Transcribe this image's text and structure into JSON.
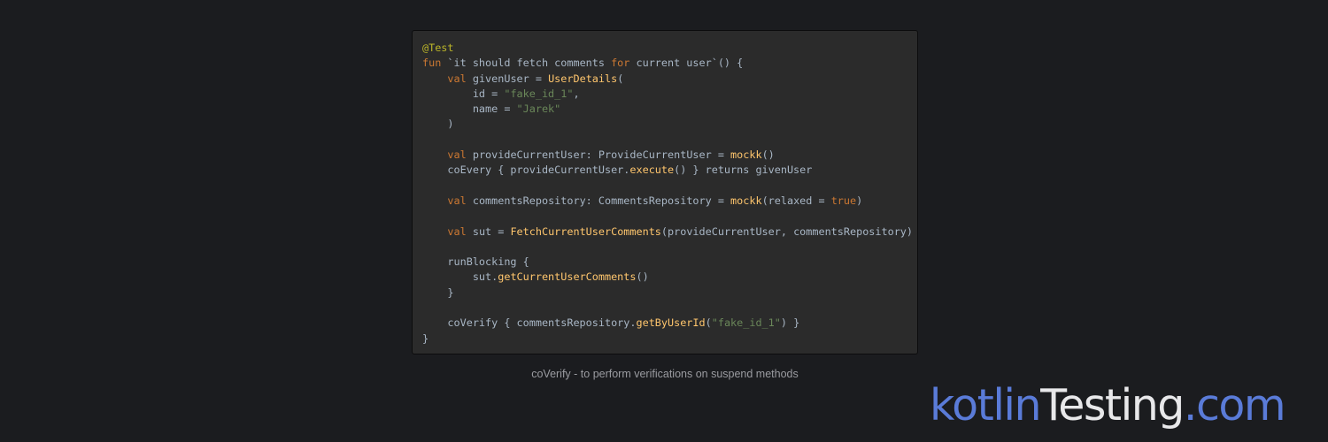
{
  "colors": {
    "background": "#1b1c1f",
    "code_background": "#2b2b2b",
    "annotation": "#bbb529",
    "keyword": "#cc7832",
    "string": "#6a8759",
    "function": "#ffc66d",
    "plain": "#a9b7c6",
    "brand_accent": "#5a7bd8",
    "brand_light": "#e8e8ea"
  },
  "code": {
    "lines": [
      [
        {
          "t": "@Test",
          "c": "annotation"
        }
      ],
      [
        {
          "t": "fun",
          "c": "keyword"
        },
        {
          "t": " `it should fetch comments ",
          "c": "plain"
        },
        {
          "t": "for",
          "c": "keyword"
        },
        {
          "t": " current user`() {",
          "c": "plain"
        }
      ],
      [
        {
          "t": "    ",
          "c": "plain"
        },
        {
          "t": "val",
          "c": "keyword"
        },
        {
          "t": " givenUser = ",
          "c": "plain"
        },
        {
          "t": "UserDetails",
          "c": "function"
        },
        {
          "t": "(",
          "c": "plain"
        }
      ],
      [
        {
          "t": "        id = ",
          "c": "plain"
        },
        {
          "t": "\"fake_id_1\"",
          "c": "string"
        },
        {
          "t": ",",
          "c": "plain"
        }
      ],
      [
        {
          "t": "        name = ",
          "c": "plain"
        },
        {
          "t": "\"Jarek\"",
          "c": "string"
        }
      ],
      [
        {
          "t": "    )",
          "c": "plain"
        }
      ],
      [],
      [
        {
          "t": "    ",
          "c": "plain"
        },
        {
          "t": "val",
          "c": "keyword"
        },
        {
          "t": " provideCurrentUser: ProvideCurrentUser = ",
          "c": "plain"
        },
        {
          "t": "mockk",
          "c": "function"
        },
        {
          "t": "()",
          "c": "plain"
        }
      ],
      [
        {
          "t": "    coEvery { provideCurrentUser.",
          "c": "plain"
        },
        {
          "t": "execute",
          "c": "function"
        },
        {
          "t": "() } returns givenUser",
          "c": "plain"
        }
      ],
      [],
      [
        {
          "t": "    ",
          "c": "plain"
        },
        {
          "t": "val",
          "c": "keyword"
        },
        {
          "t": " commentsRepository: CommentsRepository = ",
          "c": "plain"
        },
        {
          "t": "mockk",
          "c": "function"
        },
        {
          "t": "(relaxed = ",
          "c": "plain"
        },
        {
          "t": "true",
          "c": "keyword"
        },
        {
          "t": ")",
          "c": "plain"
        }
      ],
      [],
      [
        {
          "t": "    ",
          "c": "plain"
        },
        {
          "t": "val",
          "c": "keyword"
        },
        {
          "t": " sut = ",
          "c": "plain"
        },
        {
          "t": "FetchCurrentUserComments",
          "c": "function"
        },
        {
          "t": "(provideCurrentUser, commentsRepository)",
          "c": "plain"
        }
      ],
      [],
      [
        {
          "t": "    runBlocking {",
          "c": "plain"
        }
      ],
      [
        {
          "t": "        sut.",
          "c": "plain"
        },
        {
          "t": "getCurrentUserComments",
          "c": "function"
        },
        {
          "t": "()",
          "c": "plain"
        }
      ],
      [
        {
          "t": "    }",
          "c": "plain"
        }
      ],
      [],
      [
        {
          "t": "    coVerify { commentsRepository.",
          "c": "plain"
        },
        {
          "t": "getByUserId",
          "c": "function"
        },
        {
          "t": "(",
          "c": "plain"
        },
        {
          "t": "\"fake_id_1\"",
          "c": "string"
        },
        {
          "t": ") }",
          "c": "plain"
        }
      ],
      [
        {
          "t": "}",
          "c": "plain"
        }
      ]
    ]
  },
  "caption": "coVerify - to perform verifications on suspend methods",
  "brand": {
    "part1": "kotlin",
    "part2": "Testing",
    "part3": ".com"
  }
}
